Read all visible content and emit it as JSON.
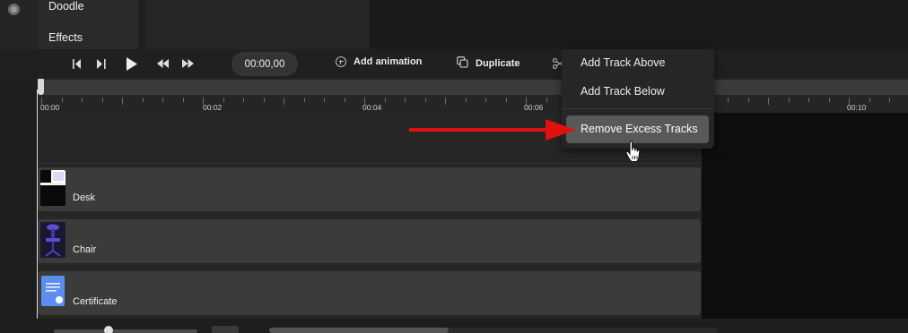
{
  "left_panel": {
    "menu_items": [
      "Doodle",
      "Effects"
    ]
  },
  "toolbar": {
    "timecode": "00:00,00",
    "add_animation_label": "Add animation",
    "duplicate_label": "Duplicate"
  },
  "ruler": {
    "tick_labels": [
      "00:00",
      "00:02",
      "00:04",
      "00:06",
      "00:10"
    ]
  },
  "tracks": [
    {
      "label": "Desk",
      "thumbnail_icon": "desk-thumbnail"
    },
    {
      "label": "Chair",
      "thumbnail_icon": "chair-thumbnail"
    },
    {
      "label": "Certificate",
      "thumbnail_icon": "certificate-thumbnail"
    }
  ],
  "context_menu": {
    "items": [
      "Add Track Above",
      "Add Track Below",
      "Remove Excess Tracks"
    ],
    "highlighted_item": "Remove Excess Tracks"
  },
  "annotation": {
    "arrow_color": "#e01010",
    "cursor": "hand-pointer"
  },
  "colors": {
    "background": "#1e1e1e",
    "track_fill": "#3b3b3b",
    "menu_highlight": "#595959",
    "arrow": "#e01010"
  }
}
